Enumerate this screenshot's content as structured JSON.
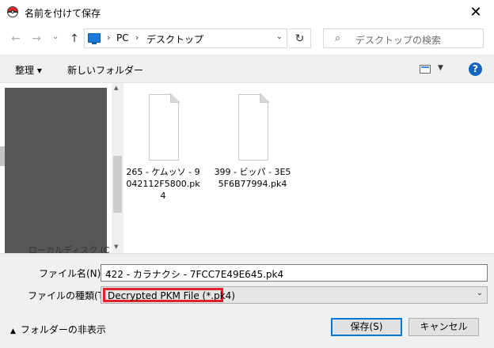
{
  "window": {
    "title": "名前を付けて保存",
    "close_glyph": "✕"
  },
  "nav": {
    "back_glyph": "←",
    "forward_glyph": "→",
    "up_glyph": "↑",
    "dropdown_glyph": "⌄",
    "breadcrumb": [
      "PC",
      "デスクトップ"
    ],
    "breadcrumb_sep": "›",
    "refresh_glyph": "↻",
    "search_placeholder": "デスクトップの検索",
    "search_glyph": "⌕"
  },
  "toolbar": {
    "organize_label": "整理 ▾",
    "new_folder_label": "新しいフォルダー",
    "help_glyph": "?",
    "view_dd_glyph": "▼"
  },
  "sidebar": {
    "partial_label": "ローカルディスク (C",
    "scroll_up": "▲",
    "scroll_down": "▼"
  },
  "files": [
    {
      "name": "265 - ケムッソ - 9042112F5800.pk4"
    },
    {
      "name": "399 - ビッパ - 3E55F6B77994.pk4"
    }
  ],
  "form": {
    "filename_label": "ファイル名(N):",
    "filename_value": "422 - カラナクシ - 7FCC7E49E645.pk4",
    "filetype_label": "ファイルの種類(T):",
    "filetype_value": "Decrypted PKM File (*.pk4)",
    "dd_glyph": "⌄"
  },
  "footer": {
    "hide_folders_label": "フォルダーの非表示",
    "hide_caret": "▲",
    "save_label": "保存(S)",
    "cancel_label": "キャンセル"
  },
  "colors": {
    "highlight_border": "#e3212a",
    "primary_button_border": "#0078d7"
  }
}
